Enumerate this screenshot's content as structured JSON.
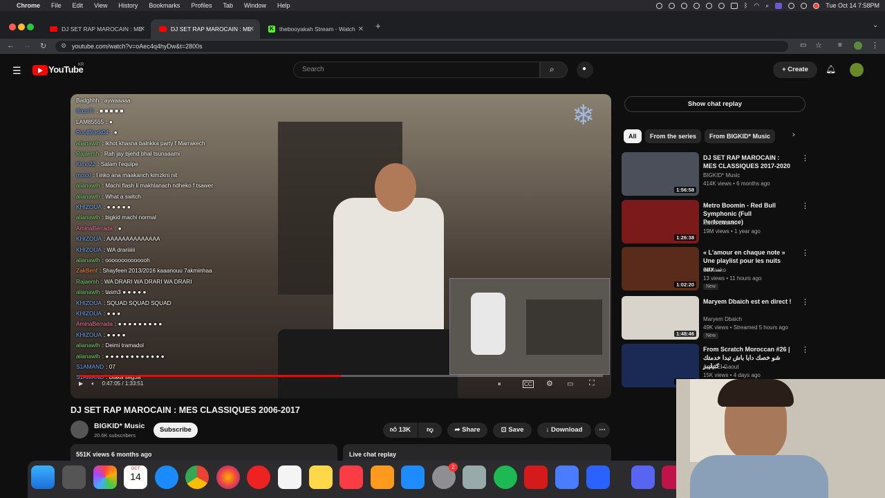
{
  "menubar": {
    "app": "Chrome",
    "items": [
      "File",
      "Edit",
      "View",
      "History",
      "Bookmarks",
      "Profiles",
      "Tab",
      "Window",
      "Help"
    ],
    "clock": "Tue Oct 14  7:58PM"
  },
  "tabs": [
    {
      "title": "DJ SET RAP MAROCAIN : ME",
      "active": false
    },
    {
      "title": "DJ SET RAP MAROCAIN : ME",
      "active": true
    },
    {
      "title": "thebooyakah Stream - Watch",
      "active": false
    }
  ],
  "address": {
    "url": "youtube.com/watch?v=oAec4q4hyDw&t=2800s"
  },
  "youtube": {
    "logo_text": "YouTube",
    "region": "KR",
    "search_placeholder": "Search",
    "create_label": "Create"
  },
  "video": {
    "time_current": "0:47:05",
    "time_total": "1:33:51",
    "progress": 0.5,
    "chat_overlay": [
      {
        "user": "Badghhh",
        "msg": ": aywaaaaa",
        "color": "#ffffff"
      },
      {
        "user": "IliassTr",
        "msg": ": ■ ■ ■ ■ ■",
        "color": "#6fa8ff"
      },
      {
        "user": "LAM85555",
        "msg": ": ●",
        "color": "#ffffff"
      },
      {
        "user": "RootBlack04",
        "msg": ": ●",
        "color": "#6fa8ff"
      },
      {
        "user": "alianawlh",
        "msg": ": lkhot khasna balnkka party f Marrakech",
        "color": "#7dd870"
      },
      {
        "user": "Rajaemh",
        "msg": ": Rah jay bjehd bhal tsunaaami",
        "color": "#7dd870"
      },
      {
        "user": "Kimo22",
        "msg": ": Salam l'equipe",
        "color": "#6fa8ff"
      },
      {
        "user": "moxxi",
        "msg": ": l inko ana maakanch kimzkni nit",
        "color": "#6fa8ff"
      },
      {
        "user": "alianawlh",
        "msg": ": Machi flash li makhlanach ndheko f tsawer",
        "color": "#7dd870"
      },
      {
        "user": "alianawlh",
        "msg": ": What a switch",
        "color": "#7dd870"
      },
      {
        "user": "KHIZOUA",
        "msg": ": ● ● ● ● ●",
        "color": "#6fa8ff"
      },
      {
        "user": "alianawlh",
        "msg": ": bigkid machi normal",
        "color": "#7dd870"
      },
      {
        "user": "AminaBerrada",
        "msg": ": ●",
        "color": "#ff7aa8"
      },
      {
        "user": "KHIZOUA",
        "msg": ": AAAAAAAAAAAAAA",
        "color": "#6fa8ff"
      },
      {
        "user": "KHIZOUA",
        "msg": ": WA drariiiiii",
        "color": "#6fa8ff"
      },
      {
        "user": "alianawlh",
        "msg": ": oooooooooooooh",
        "color": "#7dd870"
      },
      {
        "user": "ZakBenf",
        "msg": ": Shayfeen 2013/2016 kaaanouu 7akminhaa",
        "color": "#ff8a3d"
      },
      {
        "user": "Rajaemh",
        "msg": ": WA DRARI WA DRARI WA DRARI",
        "color": "#7dd870"
      },
      {
        "user": "alianawlh",
        "msg": ": tasm3 ● ● ● ● ●",
        "color": "#7dd870"
      },
      {
        "user": "KHIZOUA",
        "msg": ": SQUAD SQUAD SQUAD",
        "color": "#6fa8ff"
      },
      {
        "user": "KHIZOUA",
        "msg": ": ● ● ●",
        "color": "#6fa8ff"
      },
      {
        "user": "AminaBerrada",
        "msg": ": ● ● ● ● ● ● ● ● ●",
        "color": "#ff7aa8"
      },
      {
        "user": "KHIZOUA",
        "msg": ": ● ● ● ●",
        "color": "#6fa8ff"
      },
      {
        "user": "alianawlh",
        "msg": ": Deimi tramadol",
        "color": "#7dd870"
      },
      {
        "user": "alianawlh",
        "msg": ": ● ● ● ● ● ● ● ● ● ● ● ●",
        "color": "#7dd870"
      },
      {
        "user": "S1AMAND",
        "msg": ": 07",
        "color": "#6fa8ff"
      },
      {
        "user": "S1AMAND",
        "msg": ": Blaka seg3a",
        "color": "#6fa8ff"
      }
    ]
  },
  "right": {
    "chat_replay_label": "Show chat replay",
    "chips": [
      "All",
      "From the series",
      "From BIGKID* Music"
    ],
    "related": [
      {
        "title": "DJ SET RAP MAROCAIN : MES CLASSIQUES 2017-2020",
        "channel": "BIGKID* Music",
        "stats": "414K views • 6 months ago",
        "duration": "1:56:58",
        "badge": "",
        "thumb": "#4a4f5a"
      },
      {
        "title": "Metro Boomin - Red Bull Symphonic (Full Performance)",
        "channel": "Metro Boomin",
        "stats": "19M views • 1 year ago",
        "duration": "1:26:38",
        "badge": "",
        "thumb": "#7a1a1a"
      },
      {
        "title": "« L'amour en chaque note » Une playlist pour les nuits aux ...",
        "channel": "udutaako",
        "stats": "13 views • 11 hours ago",
        "duration": "1:02:20",
        "badge": "New",
        "thumb": "#5a2a1a"
      },
      {
        "title": "Maryem Dbaich est en direct !",
        "channel": "Maryem Dbaich",
        "stats": "49K views • Streamed 5 hours ago",
        "duration": "1:48:46",
        "badge": "New",
        "thumb": "#d8d4cc"
      },
      {
        "title": "From Scratch Moroccan #26 | شو خصك دابا باش تبدا خدمتك كتيليبر ...",
        "channel": "Amin El Gaout",
        "stats": "15K views • 4 days ago",
        "duration": "1:14:10",
        "badge": "",
        "thumb": "#1a2a55"
      }
    ]
  },
  "below": {
    "title": "DJ SET RAP MAROCAIN : MES CLASSIQUES 2006-2017",
    "channel": "BIGKID* Music",
    "subs": "20.6K subscribers",
    "subscribe": "Subscribe",
    "likes": "13K",
    "share": "Share",
    "save": "Save",
    "download": "Download",
    "meta": "551K views  6 months ago",
    "live_chat": "Live chat replay"
  },
  "dock": {
    "calendar_month": "OCT",
    "calendar_day": "14",
    "badge_count": "2"
  }
}
